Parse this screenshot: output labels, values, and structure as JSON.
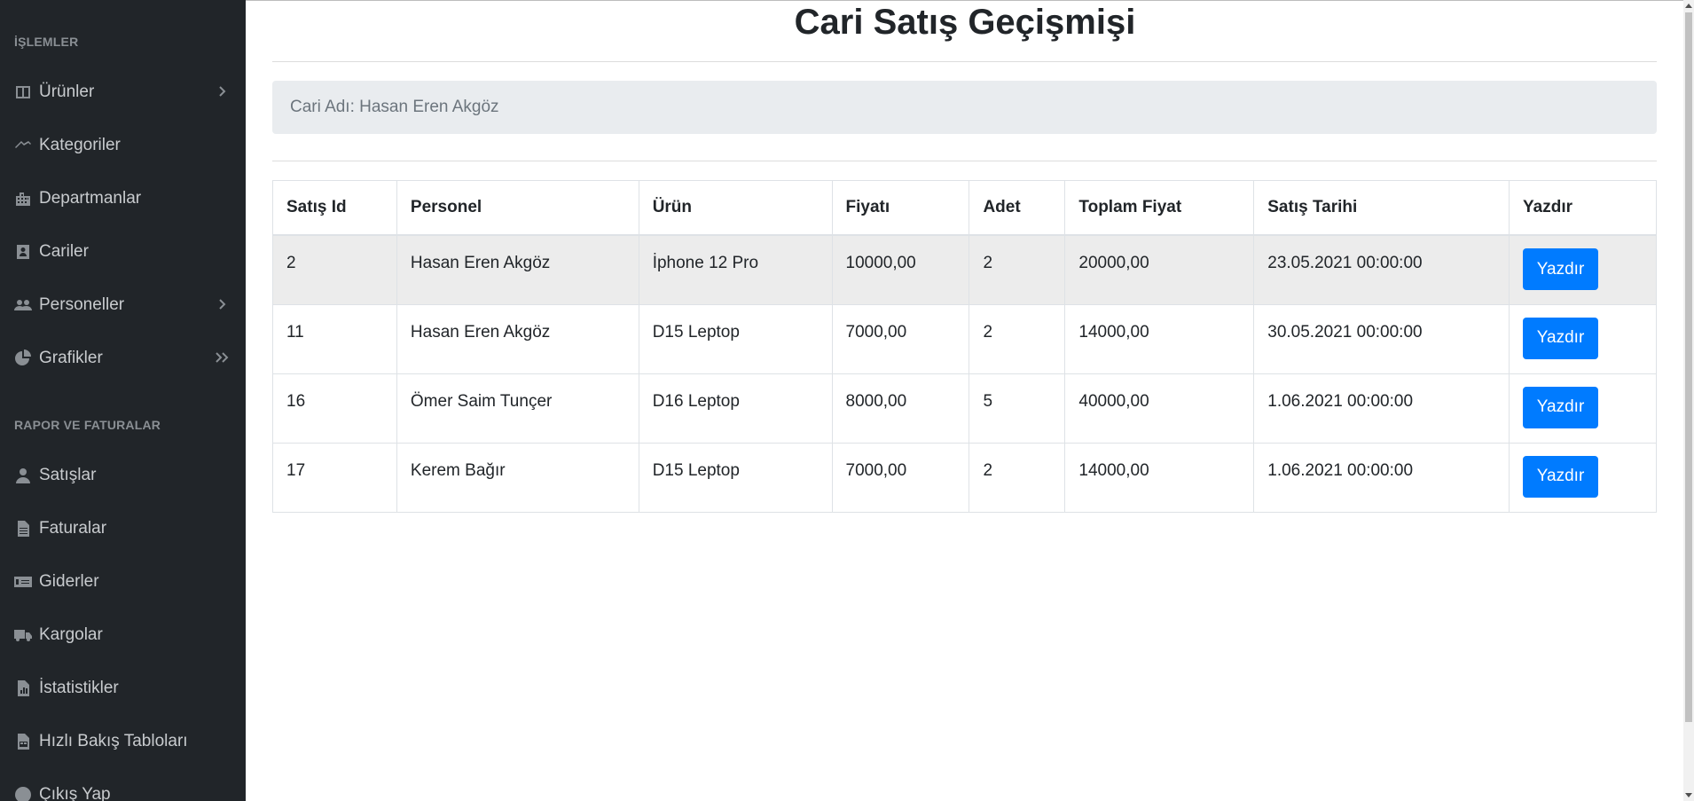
{
  "sidebar": {
    "section1": "İŞLEMLER",
    "section2": "RAPOR VE FATURALAR",
    "items": [
      {
        "label": "Ürünler",
        "icon": "table-icon"
      },
      {
        "label": "Kategoriler",
        "icon": "tags-icon"
      },
      {
        "label": "Departmanlar",
        "icon": "building-icon"
      },
      {
        "label": "Cariler",
        "icon": "contact-icon"
      },
      {
        "label": "Personeller",
        "icon": "users-icon"
      },
      {
        "label": "Grafikler",
        "icon": "pie-chart-icon"
      },
      {
        "label": "Satışlar",
        "icon": "user-icon"
      },
      {
        "label": "Faturalar",
        "icon": "file-icon"
      },
      {
        "label": "Giderler",
        "icon": "money-icon"
      },
      {
        "label": "Kargolar",
        "icon": "truck-icon"
      },
      {
        "label": "İstatistikler",
        "icon": "file-chart-icon"
      },
      {
        "label": "Hızlı Bakış Tabloları",
        "icon": "file-table-icon"
      },
      {
        "label": "Çıkış Yap",
        "icon": "power-icon"
      }
    ]
  },
  "main": {
    "title": "Cari Satış Geçişmişi",
    "cari_label": "Cari Adı: Hasan Eren Akgöz",
    "table": {
      "headers": [
        "Satış Id",
        "Personel",
        "Ürün",
        "Fiyatı",
        "Adet",
        "Toplam Fiyat",
        "Satış Tarihi",
        "Yazdır"
      ],
      "rows": [
        [
          "2",
          "Hasan Eren Akgöz",
          "İphone 12 Pro",
          "10000,00",
          "2",
          "20000,00",
          "23.05.2021 00:00:00",
          "Yazdır"
        ],
        [
          "11",
          "Hasan Eren Akgöz",
          "D15 Leptop",
          "7000,00",
          "2",
          "14000,00",
          "30.05.2021 00:00:00",
          "Yazdır"
        ],
        [
          "16",
          "Ömer Saim Tunçer",
          "D16 Leptop",
          "8000,00",
          "5",
          "40000,00",
          "1.06.2021 00:00:00",
          "Yazdır"
        ],
        [
          "17",
          "Kerem Bağır",
          "D15 Leptop",
          "7000,00",
          "2",
          "14000,00",
          "1.06.2021 00:00:00",
          "Yazdır"
        ]
      ]
    }
  },
  "colors": {
    "sidebar_bg": "#212529",
    "button_primary": "#007bff",
    "cari_box_bg": "#e9ecef"
  }
}
